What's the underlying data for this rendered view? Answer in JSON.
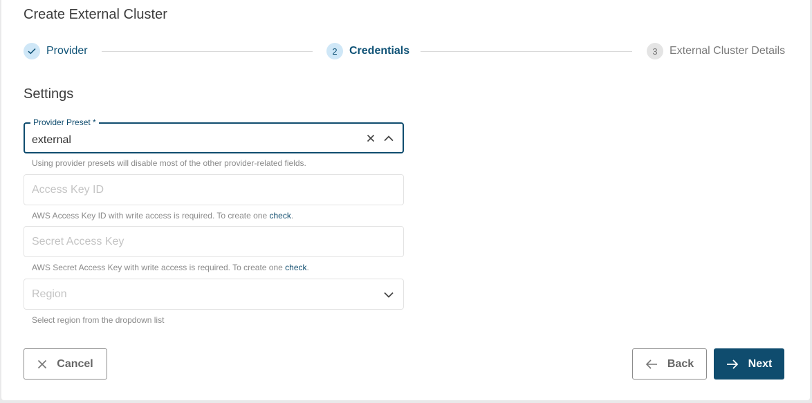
{
  "dialog": {
    "title": "Create External Cluster"
  },
  "stepper": {
    "steps": [
      {
        "label": "Provider",
        "marker": "check-icon",
        "state": "completed"
      },
      {
        "label": "Credentials",
        "number": "2",
        "state": "active"
      },
      {
        "label": "External Cluster Details",
        "number": "3",
        "state": "pending"
      }
    ]
  },
  "settings": {
    "title": "Settings",
    "provider_preset": {
      "label": "Provider Preset *",
      "value": "external",
      "hint": "Using provider presets will disable most of the other provider-related fields."
    },
    "access_key_id": {
      "placeholder": "Access Key ID",
      "hint_text": "AWS Access Key ID with write access is required. To create one ",
      "hint_link": "check",
      "hint_end": "."
    },
    "secret_access_key": {
      "placeholder": "Secret Access Key",
      "hint_text": "AWS Secret Access Key with write access is required. To create one ",
      "hint_link": "check",
      "hint_end": "."
    },
    "region": {
      "placeholder": "Region",
      "hint": "Select region from the dropdown list"
    }
  },
  "actions": {
    "cancel_label": "Cancel",
    "back_label": "Back",
    "next_label": "Next"
  },
  "colors": {
    "primary": "#0f4c6e",
    "step_active_bg": "#cfe7f7",
    "step_pending_bg": "#e4e4e4"
  }
}
